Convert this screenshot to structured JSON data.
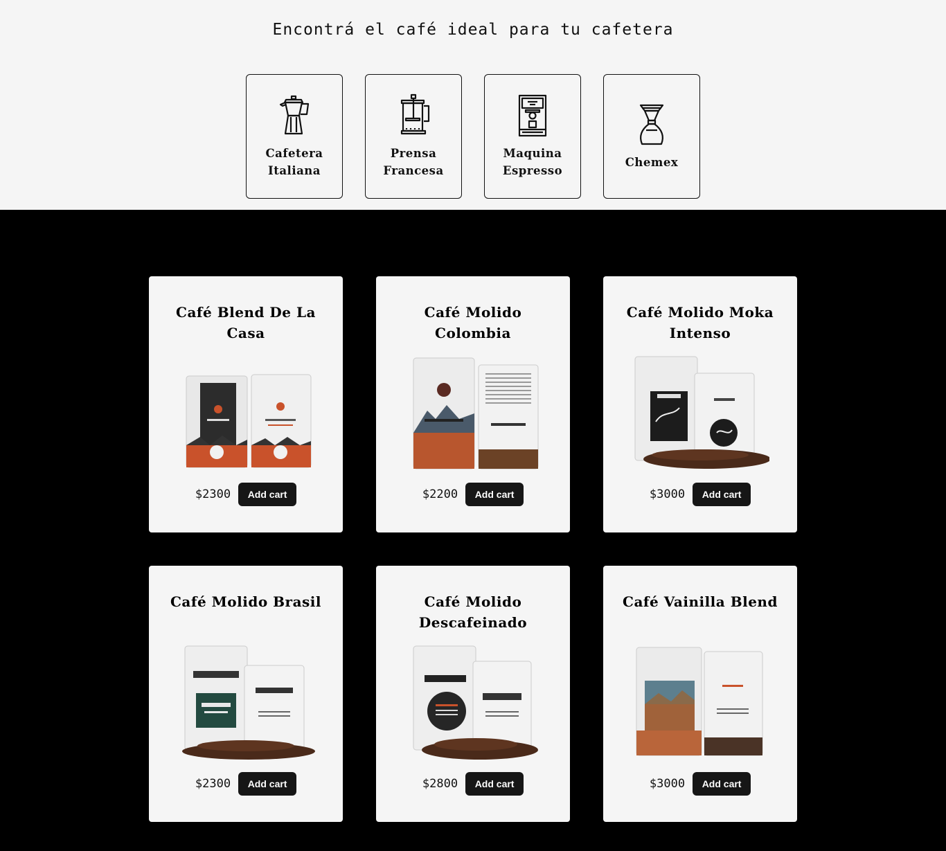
{
  "header": {
    "title": "Encontrá el café ideal para tu cafetera"
  },
  "makers": [
    {
      "icon": "moka-pot-icon",
      "label": "Cafetera Italiana"
    },
    {
      "icon": "french-press-icon",
      "label": "Prensa Francesa"
    },
    {
      "icon": "espresso-machine-icon",
      "label": "Maquina Espresso"
    },
    {
      "icon": "chemex-icon",
      "label": "Chemex"
    }
  ],
  "products": [
    {
      "name": "Café Blend De La Casa",
      "price": "$2300",
      "button": "Add cart",
      "accent": "#c9522b",
      "style": "dark-label"
    },
    {
      "name": "Café Molido Colombia",
      "price": "$2200",
      "button": "Add cart",
      "accent": "#b8562e",
      "style": "mountain"
    },
    {
      "name": "Café Molido Moka Intenso",
      "price": "$3000",
      "button": "Add cart",
      "accent": "#1c1c1c",
      "style": "mono-beans"
    },
    {
      "name": "Café Molido Brasil",
      "price": "$2300",
      "button": "Add cart",
      "accent": "#234a40",
      "style": "green-beans"
    },
    {
      "name": "Café Molido Descafeinado",
      "price": "$2800",
      "button": "Add cart",
      "accent": "#262626",
      "style": "round-beans"
    },
    {
      "name": "Café Vainilla Blend",
      "price": "$3000",
      "button": "Add cart",
      "accent": "#b9653a",
      "style": "landscape"
    }
  ]
}
